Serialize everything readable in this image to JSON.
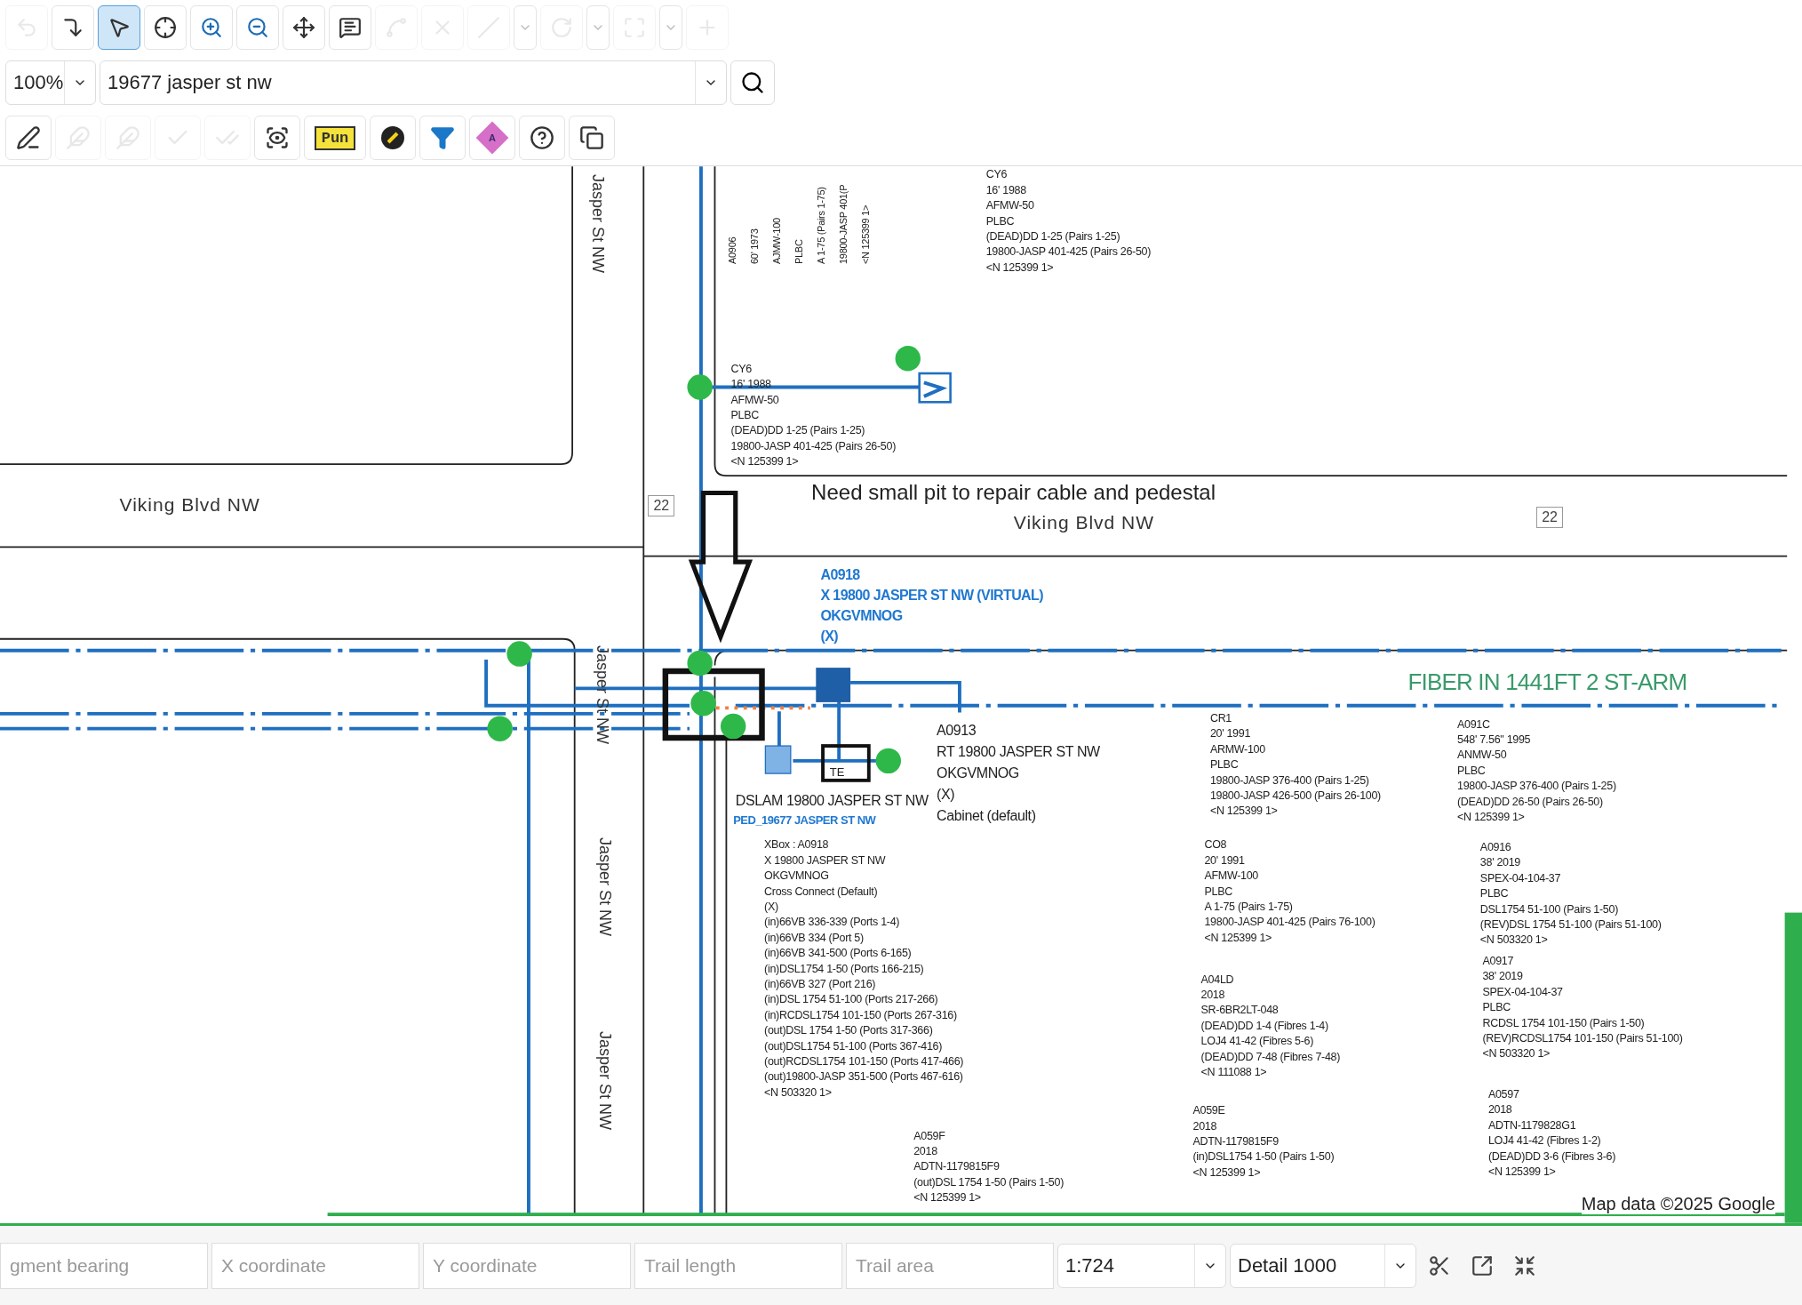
{
  "toolbar": [
    {
      "kind": "icon",
      "selected": false,
      "disabled": true
    },
    {
      "kind": "icon",
      "selected": false,
      "disabled": false
    },
    {
      "kind": "icon",
      "selected": true,
      "disabled": false
    },
    {
      "kind": "icon",
      "selected": false,
      "disabled": false
    },
    {
      "kind": "icon",
      "selected": false,
      "disabled": false
    },
    {
      "kind": "icon",
      "selected": false,
      "disabled": false
    },
    {
      "kind": "icon",
      "selected": false,
      "disabled": false
    },
    {
      "kind": "icon",
      "selected": false,
      "disabled": false
    },
    {
      "kind": "icon",
      "selected": false,
      "disabled": true
    },
    {
      "kind": "icon",
      "selected": false,
      "disabled": true
    },
    {
      "kind": "split",
      "selected": false,
      "disabled": true
    },
    {
      "kind": "split",
      "selected": false,
      "disabled": true
    },
    {
      "kind": "split",
      "selected": false,
      "disabled": true
    },
    {
      "kind": "icon",
      "selected": false,
      "disabled": true
    }
  ],
  "zoom": {
    "value": "100%"
  },
  "search": {
    "value": "19677 jasper st nw"
  },
  "tools": [
    {
      "kind": "icon",
      "disabled": false
    },
    {
      "kind": "icon",
      "disabled": true
    },
    {
      "kind": "icon",
      "disabled": true
    },
    {
      "kind": "icon",
      "disabled": true
    },
    {
      "kind": "icon",
      "disabled": true
    },
    {
      "kind": "icon",
      "disabled": false
    },
    {
      "kind": "tag",
      "label": "Pun",
      "disabled": false
    },
    {
      "kind": "icon",
      "disabled": false
    },
    {
      "kind": "icon",
      "disabled": false
    },
    {
      "kind": "diamond",
      "label": "A",
      "disabled": false
    },
    {
      "kind": "icon",
      "disabled": false
    },
    {
      "kind": "icon",
      "disabled": false
    }
  ],
  "map": {
    "street_labels": [
      "Jasper St NW",
      "Viking Blvd NW",
      "Viking Blvd NW",
      "Jasper St NW",
      "Jasper St NW",
      "Jasper St NW"
    ],
    "route_shields": [
      "22",
      "22"
    ],
    "annotation": "Need small pit to repair cable and pedestal",
    "cable_route_label": "FIBER IN 1441FT 2 ST-ARM",
    "equipment": [
      {
        "label": "TE"
      }
    ],
    "labels": [
      {
        "kind": "rotated",
        "lines": [
          "A0906",
          "60' 1973",
          "AJMW-100",
          "PLBC",
          "A 1-75 (Pairs 1-75)",
          "19800-JASP 401(P",
          "<N 125399 1>"
        ]
      },
      {
        "kind": "plain",
        "lines": [
          "CY6",
          "16' 1988",
          "AFMW-50",
          "PLBC",
          "(DEAD)DD 1-25 (Pairs 1-25)",
          "19800-JASP 401-425 (Pairs 26-50)",
          "<N 125399 1>"
        ]
      },
      {
        "kind": "plain",
        "lines": [
          "CY6",
          "16' 1988",
          "AFMW-50",
          "PLBC",
          "(DEAD)DD 1-25 (Pairs 1-25)",
          "19800-JASP 401-425 (Pairs 26-50)",
          "<N 125399 1>"
        ]
      },
      {
        "kind": "callout",
        "lines": [
          "A0918",
          "X 19800 JASPER ST NW (VIRTUAL)",
          "OKGVMNOG",
          "(X)"
        ]
      },
      {
        "kind": "large",
        "lines": [
          "A0913",
          "RT 19800 JASPER ST NW",
          "OKGVMNOG",
          "(X)",
          "Cabinet (default)"
        ]
      },
      {
        "kind": "large",
        "lines": [
          "DSLAM 19800 JASPER ST NW"
        ]
      },
      {
        "kind": "tag",
        "lines": [
          "PED_19677 JASPER ST NW"
        ]
      },
      {
        "kind": "plain",
        "lines": [
          "XBox : A0918",
          "X 19800 JASPER ST NW",
          "OKGVMNOG",
          "Cross Connect (Default)",
          "(X)",
          "(in)66VB 336-339 (Ports 1-4)",
          "(in)66VB 334 (Port 5)",
          "(in)66VB 341-500 (Ports 6-165)",
          "(in)DSL1754 1-50 (Ports 166-215)",
          "(in)66VB 327 (Port 216)",
          "(in)DSL 1754 51-100 (Ports 217-266)",
          "(in)RCDSL1754 101-150 (Ports 267-316)",
          "(out)DSL 1754 1-50 (Ports 317-366)",
          "(out)DSL1754 51-100 (Ports 367-416)",
          "(out)RCDSL1754 101-150 (Ports 417-466)",
          "(out)19800-JASP 351-500 (Ports 467-616)",
          "<N 503320 1>"
        ]
      },
      {
        "kind": "plain",
        "lines": [
          "A059F",
          "2018",
          "ADTN-1179815F9",
          "(out)DSL 1754 1-50 (Pairs 1-50)",
          "<N 125399 1>"
        ]
      },
      {
        "kind": "plain",
        "lines": [
          "CR1",
          "20' 1991",
          "ARMW-100",
          "PLBC",
          "19800-JASP 376-400 (Pairs 1-25)",
          "19800-JASP 426-500 (Pairs 26-100)",
          "<N 125399 1>"
        ]
      },
      {
        "kind": "plain",
        "lines": [
          "CO8",
          "20' 1991",
          "AFMW-100",
          "PLBC",
          "A 1-75 (Pairs 1-75)",
          "19800-JASP 401-425 (Pairs 76-100)",
          "<N 125399 1>"
        ]
      },
      {
        "kind": "plain",
        "lines": [
          "A04LD",
          "2018",
          "SR-6BR2LT-048",
          "(DEAD)DD 1-4 (Fibres 1-4)",
          "LOJ4 41-42 (Fibres 5-6)",
          "(DEAD)DD 7-48 (Fibres 7-48)",
          "<N 111088 1>"
        ]
      },
      {
        "kind": "plain",
        "lines": [
          "A059E",
          "2018",
          "ADTN-1179815F9",
          "(in)DSL1754 1-50 (Pairs 1-50)",
          "<N 125399 1>"
        ]
      },
      {
        "kind": "plain",
        "lines": [
          "A091C",
          "548' 7.56\" 1995",
          "ANMW-50",
          "PLBC",
          "19800-JASP 376-400 (Pairs 1-25)",
          "(DEAD)DD 26-50 (Pairs 26-50)",
          "<N 125399 1>"
        ]
      },
      {
        "kind": "plain",
        "lines": [
          "A0916",
          "38' 2019",
          "SPEX-04-104-37",
          "PLBC",
          "DSL1754 51-100 (Pairs 1-50)",
          "(REV)DSL 1754 51-100 (Pairs 51-100)",
          "<N 503320 1>"
        ]
      },
      {
        "kind": "plain",
        "lines": [
          "A0917",
          "38' 2019",
          "SPEX-04-104-37",
          "PLBC",
          "RCDSL 1754 101-150 (Pairs 1-50)",
          "(REV)RCDSL1754 101-150 (Pairs 51-100)",
          "<N 503320 1>"
        ]
      },
      {
        "kind": "plain",
        "lines": [
          "A0597",
          "2018",
          "ADTN-1179828G1",
          "LOJ4 41-42 (Fibres 1-2)",
          "(DEAD)DD 3-6 (Fibres 3-6)",
          "<N 125399 1>"
        ]
      }
    ],
    "attribution": "Map data ©2025 Google"
  },
  "status_bar": {
    "fields": [
      {
        "placeholder": "gment bearing"
      },
      {
        "placeholder": "X coordinate"
      },
      {
        "placeholder": "Y coordinate"
      },
      {
        "placeholder": "Trail length"
      },
      {
        "placeholder": "Trail area"
      }
    ],
    "scale": "1:724",
    "detail": "Detail 1000"
  }
}
